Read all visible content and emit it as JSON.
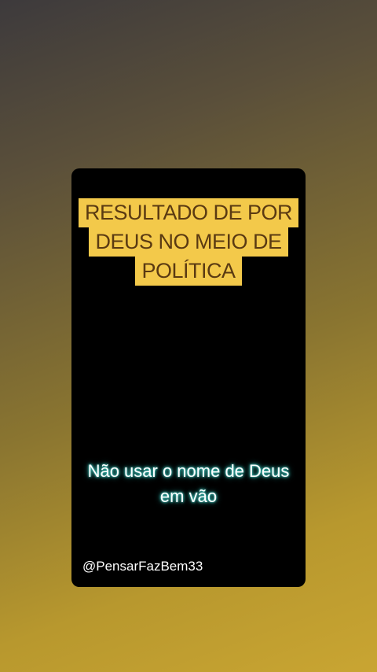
{
  "video": {
    "title_lines": [
      "RESULTADO DE POR",
      "DEUS NO MEIO DE",
      "POLÍTICA"
    ],
    "caption_lines": [
      "Não usar o nome de Deus",
      "em vão"
    ],
    "watermark": "@PensarFazBem33"
  },
  "colors": {
    "title_background": "#f3c94a",
    "title_text": "#5a3a12",
    "caption_glow": "#3fc9c0",
    "card_background": "#000000"
  }
}
